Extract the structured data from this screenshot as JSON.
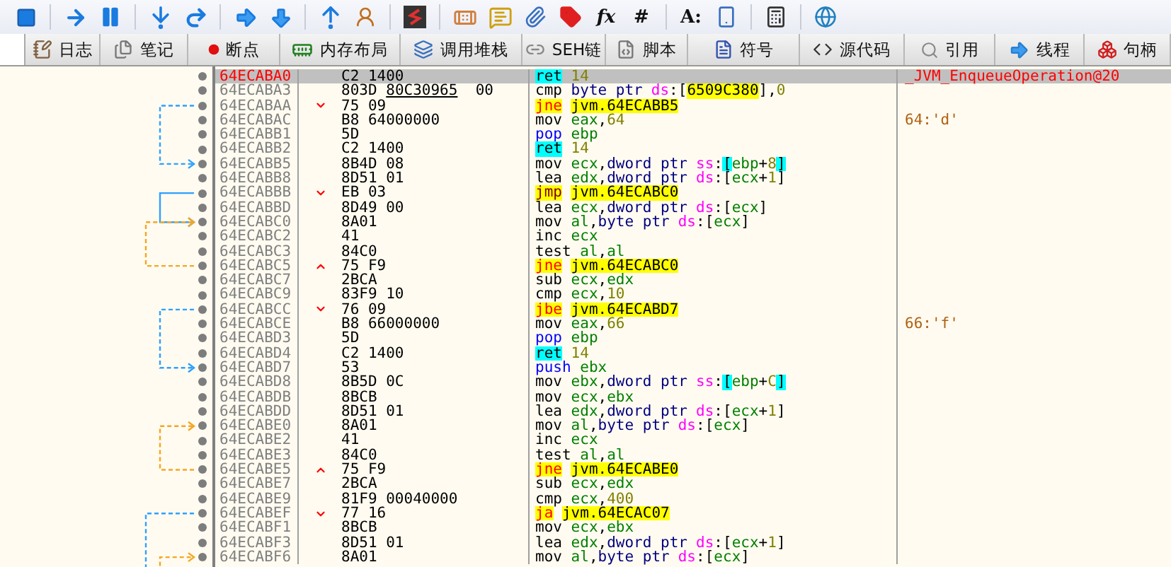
{
  "toolbar": [
    {
      "kind": "icon"
    },
    {
      "kind": "icon"
    },
    {
      "kind": "icon"
    },
    {
      "kind": "icon"
    },
    {
      "kind": "icon"
    },
    {
      "kind": "icon"
    },
    {
      "kind": "icon"
    },
    {
      "kind": "icon"
    },
    {
      "kind": "icon"
    },
    {
      "kind": "icon"
    },
    {
      "kind": "icon"
    },
    {
      "kind": "icon"
    },
    {
      "kind": "icon"
    },
    {
      "kind": "icon"
    },
    {
      "kind": "text",
      "label": "fx"
    },
    {
      "kind": "text",
      "label": "#"
    },
    {
      "kind": "text",
      "label": "A:"
    },
    {
      "kind": "icon"
    },
    {
      "kind": "icon"
    },
    {
      "kind": "icon"
    }
  ],
  "tabs": [
    {
      "label": "日志",
      "selected": false
    },
    {
      "label": "笔记",
      "selected": false
    },
    {
      "label": "断点",
      "selected": false
    },
    {
      "label": "内存布局",
      "selected": false
    },
    {
      "label": "调用堆栈",
      "selected": false
    },
    {
      "label": "SEH链",
      "selected": false
    },
    {
      "label": "脚本",
      "selected": false
    },
    {
      "label": "符号",
      "selected": false
    },
    {
      "label": "源代码",
      "selected": false
    },
    {
      "label": "引用",
      "selected": false
    },
    {
      "label": "线程",
      "selected": false
    },
    {
      "label": "句柄",
      "selected": false
    }
  ],
  "rows": [
    {
      "address": "64ECABA0",
      "selected": true,
      "jump_down": false,
      "jump_up": false,
      "bytes": "C2 1400",
      "kind": "ret",
      "mnemonic": "ret",
      "ops": [
        {
          "kind": "number",
          "text": "14"
        }
      ],
      "comment": {
        "kind": "label",
        "text": "_JVM_EnqueueOperation@20"
      }
    },
    {
      "address": "64ECABA3",
      "selected": false,
      "jump_down": false,
      "jump_up": false,
      "bytes": "803D",
      "bytes_link": "80C30965",
      "bytes_tail": "00",
      "kind": "normal",
      "mnemonic": "cmp",
      "ops": [
        {
          "kind": "size",
          "text": "byte ptr"
        },
        {
          "kind": "segment",
          "text": "ds"
        },
        {
          "kind": "punct",
          "text": ":["
        },
        {
          "kind": "address",
          "text": "6509C380"
        },
        {
          "kind": "punct",
          "text": "],"
        },
        {
          "kind": "number",
          "text": "0"
        }
      ]
    },
    {
      "address": "64ECABAA",
      "selected": false,
      "jump_down": true,
      "jump_up": false,
      "bytes": "75 09",
      "kind": "jcc",
      "mnemonic": "jne",
      "ops": [
        {
          "kind": "target",
          "text": "jvm.64ECABB5"
        }
      ]
    },
    {
      "address": "64ECABAC",
      "selected": false,
      "jump_down": false,
      "jump_up": false,
      "bytes": "B8 64000000",
      "kind": "normal",
      "mnemonic": "mov",
      "ops": [
        {
          "kind": "register",
          "text": "eax"
        },
        {
          "kind": "punct",
          "text": ","
        },
        {
          "kind": "number",
          "text": "64"
        }
      ],
      "comment": {
        "kind": "char",
        "text": "64:'d'"
      }
    },
    {
      "address": "64ECABB1",
      "selected": false,
      "jump_down": false,
      "jump_up": false,
      "bytes": "5D",
      "kind": "stack",
      "mnemonic": "pop",
      "ops": [
        {
          "kind": "register",
          "text": "ebp"
        }
      ]
    },
    {
      "address": "64ECABB2",
      "selected": false,
      "jump_down": false,
      "jump_up": false,
      "bytes": "C2 1400",
      "kind": "ret",
      "mnemonic": "ret",
      "ops": [
        {
          "kind": "number",
          "text": "14"
        }
      ]
    },
    {
      "address": "64ECABB5",
      "selected": false,
      "jump_down": false,
      "jump_up": false,
      "bytes": "8B4D 08",
      "kind": "normal",
      "mnemonic": "mov",
      "ops": [
        {
          "kind": "register",
          "text": "ecx"
        },
        {
          "kind": "punct",
          "text": ","
        },
        {
          "kind": "size",
          "text": "dword ptr"
        },
        {
          "kind": "segment",
          "text": "ss"
        },
        {
          "kind": "punct",
          "text": ":"
        },
        {
          "kind": "bracket",
          "text": "["
        },
        {
          "kind": "register",
          "text": "ebp"
        },
        {
          "kind": "punct",
          "text": "+"
        },
        {
          "kind": "number",
          "text": "8"
        },
        {
          "kind": "bracket",
          "text": "]"
        }
      ]
    },
    {
      "address": "64ECABB8",
      "selected": false,
      "jump_down": false,
      "jump_up": false,
      "bytes": "8D51 01",
      "kind": "normal",
      "mnemonic": "lea",
      "ops": [
        {
          "kind": "register",
          "text": "edx"
        },
        {
          "kind": "punct",
          "text": ","
        },
        {
          "kind": "size",
          "text": "dword ptr"
        },
        {
          "kind": "segment",
          "text": "ds"
        },
        {
          "kind": "punct",
          "text": ":["
        },
        {
          "kind": "register",
          "text": "ecx"
        },
        {
          "kind": "punct",
          "text": "+"
        },
        {
          "kind": "number",
          "text": "1"
        },
        {
          "kind": "punct",
          "text": "]"
        }
      ]
    },
    {
      "address": "64ECABBB",
      "selected": false,
      "jump_down": true,
      "jump_up": false,
      "bytes": "EB 03",
      "kind": "jmp",
      "mnemonic": "jmp",
      "ops": [
        {
          "kind": "target",
          "text": "jvm.64ECABC0"
        }
      ]
    },
    {
      "address": "64ECABBD",
      "selected": false,
      "jump_down": false,
      "jump_up": false,
      "bytes": "8D49 00",
      "kind": "normal",
      "mnemonic": "lea",
      "ops": [
        {
          "kind": "register",
          "text": "ecx"
        },
        {
          "kind": "punct",
          "text": ","
        },
        {
          "kind": "size",
          "text": "dword ptr"
        },
        {
          "kind": "segment",
          "text": "ds"
        },
        {
          "kind": "punct",
          "text": ":["
        },
        {
          "kind": "register",
          "text": "ecx"
        },
        {
          "kind": "punct",
          "text": "]"
        }
      ]
    },
    {
      "address": "64ECABC0",
      "selected": false,
      "jump_down": false,
      "jump_up": false,
      "bytes": "8A01",
      "kind": "normal",
      "mnemonic": "mov",
      "ops": [
        {
          "kind": "register",
          "text": "al"
        },
        {
          "kind": "punct",
          "text": ","
        },
        {
          "kind": "size",
          "text": "byte ptr"
        },
        {
          "kind": "segment",
          "text": "ds"
        },
        {
          "kind": "punct",
          "text": ":["
        },
        {
          "kind": "register",
          "text": "ecx"
        },
        {
          "kind": "punct",
          "text": "]"
        }
      ]
    },
    {
      "address": "64ECABC2",
      "selected": false,
      "jump_down": false,
      "jump_up": false,
      "bytes": "41",
      "kind": "normal",
      "mnemonic": "inc",
      "ops": [
        {
          "kind": "register",
          "text": "ecx"
        }
      ]
    },
    {
      "address": "64ECABC3",
      "selected": false,
      "jump_down": false,
      "jump_up": false,
      "bytes": "84C0",
      "kind": "normal",
      "mnemonic": "test",
      "ops": [
        {
          "kind": "register",
          "text": "al"
        },
        {
          "kind": "punct",
          "text": ","
        },
        {
          "kind": "register",
          "text": "al"
        }
      ]
    },
    {
      "address": "64ECABC5",
      "selected": false,
      "jump_down": false,
      "jump_up": true,
      "bytes": "75 F9",
      "kind": "jcc",
      "mnemonic": "jne",
      "ops": [
        {
          "kind": "target",
          "text": "jvm.64ECABC0"
        }
      ]
    },
    {
      "address": "64ECABC7",
      "selected": false,
      "jump_down": false,
      "jump_up": false,
      "bytes": "2BCA",
      "kind": "normal",
      "mnemonic": "sub",
      "ops": [
        {
          "kind": "register",
          "text": "ecx"
        },
        {
          "kind": "punct",
          "text": ","
        },
        {
          "kind": "register",
          "text": "edx"
        }
      ]
    },
    {
      "address": "64ECABC9",
      "selected": false,
      "jump_down": false,
      "jump_up": false,
      "bytes": "83F9 10",
      "kind": "normal",
      "mnemonic": "cmp",
      "ops": [
        {
          "kind": "register",
          "text": "ecx"
        },
        {
          "kind": "punct",
          "text": ","
        },
        {
          "kind": "number",
          "text": "10"
        }
      ]
    },
    {
      "address": "64ECABCC",
      "selected": false,
      "jump_down": true,
      "jump_up": false,
      "bytes": "76 09",
      "kind": "jcc",
      "mnemonic": "jbe",
      "ops": [
        {
          "kind": "target",
          "text": "jvm.64ECABD7"
        }
      ]
    },
    {
      "address": "64ECABCE",
      "selected": false,
      "jump_down": false,
      "jump_up": false,
      "bytes": "B8 66000000",
      "kind": "normal",
      "mnemonic": "mov",
      "ops": [
        {
          "kind": "register",
          "text": "eax"
        },
        {
          "kind": "punct",
          "text": ","
        },
        {
          "kind": "number",
          "text": "66"
        }
      ],
      "comment": {
        "kind": "char",
        "text": "66:'f'"
      }
    },
    {
      "address": "64ECABD3",
      "selected": false,
      "jump_down": false,
      "jump_up": false,
      "bytes": "5D",
      "kind": "stack",
      "mnemonic": "pop",
      "ops": [
        {
          "kind": "register",
          "text": "ebp"
        }
      ]
    },
    {
      "address": "64ECABD4",
      "selected": false,
      "jump_down": false,
      "jump_up": false,
      "bytes": "C2 1400",
      "kind": "ret",
      "mnemonic": "ret",
      "ops": [
        {
          "kind": "number",
          "text": "14"
        }
      ]
    },
    {
      "address": "64ECABD7",
      "selected": false,
      "jump_down": false,
      "jump_up": false,
      "bytes": "53",
      "kind": "stack",
      "mnemonic": "push",
      "ops": [
        {
          "kind": "register",
          "text": "ebx"
        }
      ]
    },
    {
      "address": "64ECABD8",
      "selected": false,
      "jump_down": false,
      "jump_up": false,
      "bytes": "8B5D 0C",
      "kind": "normal",
      "mnemonic": "mov",
      "ops": [
        {
          "kind": "register",
          "text": "ebx"
        },
        {
          "kind": "punct",
          "text": ","
        },
        {
          "kind": "size",
          "text": "dword ptr"
        },
        {
          "kind": "segment",
          "text": "ss"
        },
        {
          "kind": "punct",
          "text": ":"
        },
        {
          "kind": "bracket",
          "text": "["
        },
        {
          "kind": "register",
          "text": "ebp"
        },
        {
          "kind": "punct",
          "text": "+"
        },
        {
          "kind": "number",
          "text": "C"
        },
        {
          "kind": "bracket",
          "text": "]"
        }
      ]
    },
    {
      "address": "64ECABDB",
      "selected": false,
      "jump_down": false,
      "jump_up": false,
      "bytes": "8BCB",
      "kind": "normal",
      "mnemonic": "mov",
      "ops": [
        {
          "kind": "register",
          "text": "ecx"
        },
        {
          "kind": "punct",
          "text": ","
        },
        {
          "kind": "register",
          "text": "ebx"
        }
      ]
    },
    {
      "address": "64ECABDD",
      "selected": false,
      "jump_down": false,
      "jump_up": false,
      "bytes": "8D51 01",
      "kind": "normal",
      "mnemonic": "lea",
      "ops": [
        {
          "kind": "register",
          "text": "edx"
        },
        {
          "kind": "punct",
          "text": ","
        },
        {
          "kind": "size",
          "text": "dword ptr"
        },
        {
          "kind": "segment",
          "text": "ds"
        },
        {
          "kind": "punct",
          "text": ":["
        },
        {
          "kind": "register",
          "text": "ecx"
        },
        {
          "kind": "punct",
          "text": "+"
        },
        {
          "kind": "number",
          "text": "1"
        },
        {
          "kind": "punct",
          "text": "]"
        }
      ]
    },
    {
      "address": "64ECABE0",
      "selected": false,
      "jump_down": false,
      "jump_up": false,
      "bytes": "8A01",
      "kind": "normal",
      "mnemonic": "mov",
      "ops": [
        {
          "kind": "register",
          "text": "al"
        },
        {
          "kind": "punct",
          "text": ","
        },
        {
          "kind": "size",
          "text": "byte ptr"
        },
        {
          "kind": "segment",
          "text": "ds"
        },
        {
          "kind": "punct",
          "text": ":["
        },
        {
          "kind": "register",
          "text": "ecx"
        },
        {
          "kind": "punct",
          "text": "]"
        }
      ]
    },
    {
      "address": "64ECABE2",
      "selected": false,
      "jump_down": false,
      "jump_up": false,
      "bytes": "41",
      "kind": "normal",
      "mnemonic": "inc",
      "ops": [
        {
          "kind": "register",
          "text": "ecx"
        }
      ]
    },
    {
      "address": "64ECABE3",
      "selected": false,
      "jump_down": false,
      "jump_up": false,
      "bytes": "84C0",
      "kind": "normal",
      "mnemonic": "test",
      "ops": [
        {
          "kind": "register",
          "text": "al"
        },
        {
          "kind": "punct",
          "text": ","
        },
        {
          "kind": "register",
          "text": "al"
        }
      ]
    },
    {
      "address": "64ECABE5",
      "selected": false,
      "jump_down": false,
      "jump_up": true,
      "bytes": "75 F9",
      "kind": "jcc",
      "mnemonic": "jne",
      "ops": [
        {
          "kind": "target",
          "text": "jvm.64ECABE0"
        }
      ]
    },
    {
      "address": "64ECABE7",
      "selected": false,
      "jump_down": false,
      "jump_up": false,
      "bytes": "2BCA",
      "kind": "normal",
      "mnemonic": "sub",
      "ops": [
        {
          "kind": "register",
          "text": "ecx"
        },
        {
          "kind": "punct",
          "text": ","
        },
        {
          "kind": "register",
          "text": "edx"
        }
      ]
    },
    {
      "address": "64ECABE9",
      "selected": false,
      "jump_down": false,
      "jump_up": false,
      "bytes": "81F9 00040000",
      "kind": "normal",
      "mnemonic": "cmp",
      "ops": [
        {
          "kind": "register",
          "text": "ecx"
        },
        {
          "kind": "punct",
          "text": ","
        },
        {
          "kind": "number",
          "text": "400"
        }
      ]
    },
    {
      "address": "64ECABEF",
      "selected": false,
      "jump_down": true,
      "jump_up": false,
      "bytes": "77 16",
      "kind": "jcc",
      "mnemonic": "ja",
      "ops": [
        {
          "kind": "target",
          "text": "jvm.64ECAC07"
        }
      ]
    },
    {
      "address": "64ECABF1",
      "selected": false,
      "jump_down": false,
      "jump_up": false,
      "bytes": "8BCB",
      "kind": "normal",
      "mnemonic": "mov",
      "ops": [
        {
          "kind": "register",
          "text": "ecx"
        },
        {
          "kind": "punct",
          "text": ","
        },
        {
          "kind": "register",
          "text": "ebx"
        }
      ]
    },
    {
      "address": "64ECABF3",
      "selected": false,
      "jump_down": false,
      "jump_up": false,
      "bytes": "8D51 01",
      "kind": "normal",
      "mnemonic": "lea",
      "ops": [
        {
          "kind": "register",
          "text": "edx"
        },
        {
          "kind": "punct",
          "text": ","
        },
        {
          "kind": "size",
          "text": "dword ptr"
        },
        {
          "kind": "segment",
          "text": "ds"
        },
        {
          "kind": "punct",
          "text": ":["
        },
        {
          "kind": "register",
          "text": "ecx"
        },
        {
          "kind": "punct",
          "text": "+"
        },
        {
          "kind": "number",
          "text": "1"
        },
        {
          "kind": "punct",
          "text": "]"
        }
      ]
    },
    {
      "address": "64ECABF6",
      "selected": false,
      "jump_down": false,
      "jump_up": false,
      "bytes": "8A01",
      "kind": "normal",
      "mnemonic": "mov",
      "ops": [
        {
          "kind": "register",
          "text": "al"
        },
        {
          "kind": "punct",
          "text": ","
        },
        {
          "kind": "size",
          "text": "byte ptr"
        },
        {
          "kind": "segment",
          "text": "ds"
        },
        {
          "kind": "punct",
          "text": ":["
        },
        {
          "kind": "register",
          "text": "ecx"
        },
        {
          "kind": "punct",
          "text": "]"
        }
      ]
    }
  ]
}
